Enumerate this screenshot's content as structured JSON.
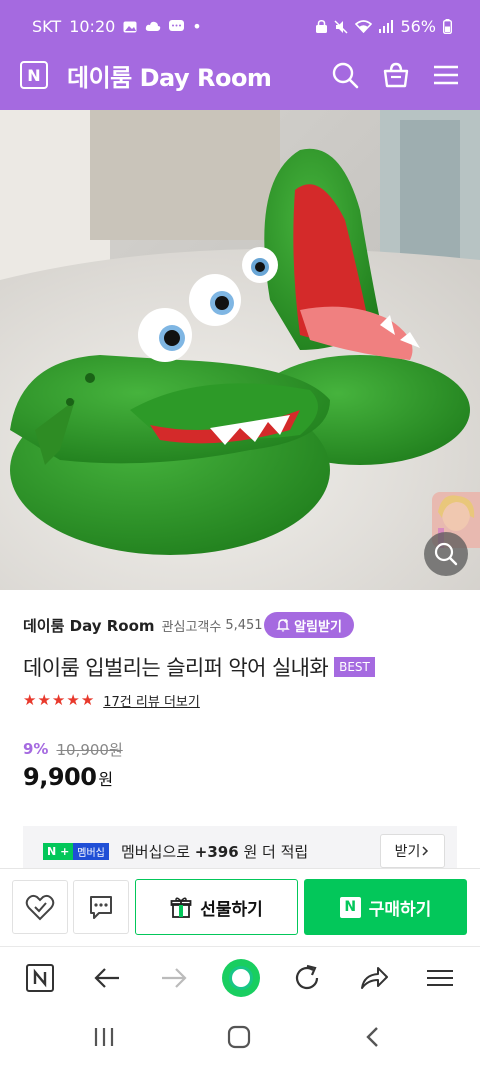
{
  "status_bar": {
    "carrier": "SKT",
    "time": "10:20",
    "dot": "•",
    "battery": "56%"
  },
  "header": {
    "logo_letter": "N",
    "title": "데이룸 Day Room",
    "icons": [
      "search-icon",
      "cart-icon",
      "menu-icon"
    ]
  },
  "product": {
    "store_name": "데이룸 Day Room",
    "fans_label": "관심고객수",
    "fans_count": "5,451",
    "alarm_label": "알림받기",
    "title": "데이룸 입벌리는 슬리퍼 악어 실내화",
    "badge": "BEST",
    "rating_stars": 5,
    "review_link": "17건 리뷰 더보기",
    "discount_rate": "9%",
    "original_price": "10,900원",
    "sale_price": "9,900",
    "price_unit": "원"
  },
  "membership": {
    "badge_n": "N",
    "badge_plus": "+",
    "badge_label": "멤버십",
    "text_prefix": "멤버십으로 ",
    "points": "+396",
    "text_suffix": " 원 더 적립",
    "receive_label": "받기"
  },
  "purchase_bar": {
    "gift_label": "선물하기",
    "buy_letter": "N",
    "buy_label": "구매하기"
  },
  "colors": {
    "brand_purple": "#a56ae0",
    "naver_green": "#03c75a",
    "star_red": "#e8392c"
  }
}
